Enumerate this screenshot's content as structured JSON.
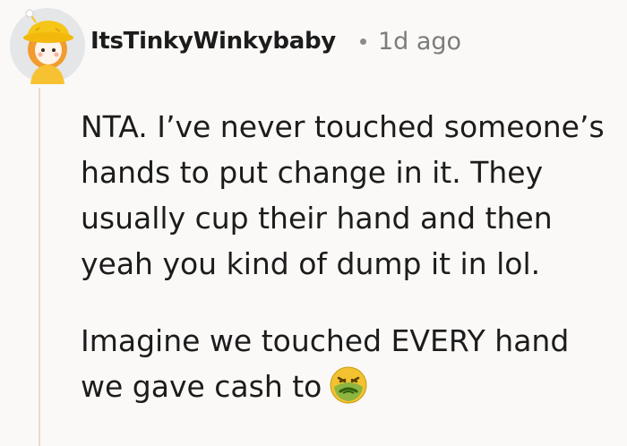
{
  "comment": {
    "author": "ItsTinkyWinkybaby",
    "separator": "•",
    "timestamp": "1d ago",
    "paragraphs": [
      "NTA. I’ve never touched someone’s\nhands to put change in it. They\nusually cup their hand and then\nyeah you kind of dump it in lol.",
      "Imagine we touched EVERY hand\nwe gave cash to"
    ],
    "emoji": "nauseated-face-emoji"
  },
  "colors": {
    "background": "#fbf9f7",
    "thread_line": "#f0d6cc",
    "text": "#1c1c1c",
    "meta": "#7c7c7c",
    "avatar_hat": "#f5c518",
    "avatar_hair": "#f29b2e",
    "emoji_face": "#f2c230",
    "emoji_green": "#7cb342"
  }
}
